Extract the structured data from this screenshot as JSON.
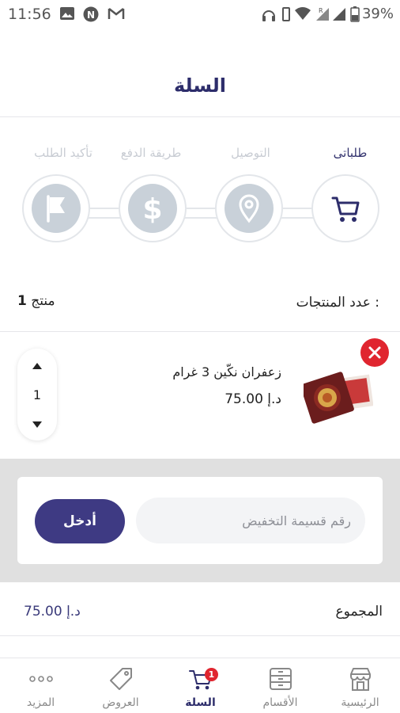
{
  "status_bar": {
    "time": "11:56",
    "battery_percent": "39%",
    "icons": [
      "image-icon",
      "n-circle-icon",
      "gmail-icon",
      "headphones-icon",
      "vibrate-icon",
      "wifi-icon",
      "signal-icon",
      "battery-icon"
    ]
  },
  "header": {
    "title": "السلة"
  },
  "steps": [
    {
      "label": "طلباتى",
      "icon": "cart-icon",
      "active": true
    },
    {
      "label": "التوصيل",
      "icon": "location-pin-icon",
      "active": false
    },
    {
      "label": "طريقة الدفع",
      "icon": "dollar-icon",
      "active": false
    },
    {
      "label": "تأكيد الطلب",
      "icon": "flag-icon",
      "active": false
    }
  ],
  "cart_summary": {
    "count_label": "عدد المنتجات :",
    "count_number": "1",
    "count_unit": "منتج"
  },
  "product": {
    "name": "زعفران نكّين 3 غرام",
    "price": "75.00",
    "currency": "د.إ",
    "quantity": "1"
  },
  "coupon": {
    "placeholder": "رقم قسيمة التخفيض",
    "button_label": "أدخل"
  },
  "total": {
    "label": "المجموع",
    "value": "75.00",
    "currency": "د.إ"
  },
  "bottom_nav": {
    "items": [
      {
        "label": "الرئيسية",
        "icon": "store-icon"
      },
      {
        "label": "الأقسام",
        "icon": "categories-icon"
      },
      {
        "label": "السلة",
        "icon": "cart-icon",
        "badge": "1",
        "active": true
      },
      {
        "label": "العروض",
        "icon": "tag-icon"
      },
      {
        "label": "المزيد",
        "icon": "more-dots-icon"
      }
    ]
  },
  "colors": {
    "primary": "#2d2d6b",
    "button": "#3e3a83",
    "danger": "#e0252f",
    "inactive_step": "#c9d1d9"
  }
}
